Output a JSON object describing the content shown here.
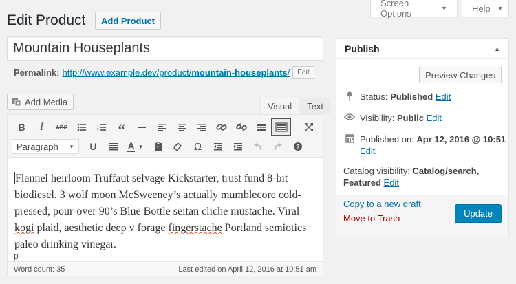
{
  "screen_tabs": {
    "screen_options": "Screen Options",
    "help": "Help"
  },
  "page": {
    "title": "Edit Product",
    "add_new": "Add Product"
  },
  "post": {
    "title": "Mountain Houseplants",
    "permalink_label": "Permalink:",
    "permalink_base": "http://www.example.dev/product/",
    "permalink_slug": "mountain-houseplants",
    "permalink_end": "/",
    "edit_label": "Edit"
  },
  "editor": {
    "add_media": "Add Media",
    "tab_visual": "Visual",
    "tab_text": "Text",
    "format_select": "Paragraph",
    "content_parts": [
      "Flannel heirloom Truffaut selvage Kickstarter, trust fund 8-bit biodiesel. 3 wolf moon McSweeney’s actually mumblecore cold-pressed, pour-over 90’s Blue Bottle seitan cliche mustache. Viral ",
      "kogi",
      " plaid, aesthetic deep v forage ",
      "fingerstache",
      " Portland semiotics paleo drinking vinegar."
    ],
    "path": "p",
    "word_count": "Word count: 35",
    "last_edited": "Last edited on April 12, 2016 at 10:51 am"
  },
  "publish": {
    "title": "Publish",
    "preview": "Preview Changes",
    "status_label": "Status:",
    "status_value": "Published",
    "visibility_label": "Visibility:",
    "visibility_value": "Public",
    "published_label": "Published on:",
    "published_value": "Apr 12, 2016 @ 10:51",
    "catalog_label": "Catalog visibility:",
    "catalog_value_1": "Catalog/search,",
    "catalog_value_2": "Featured",
    "edit": "Edit",
    "copy_draft": "Copy to a new draft",
    "trash": "Move to Trash",
    "update": "Update"
  }
}
